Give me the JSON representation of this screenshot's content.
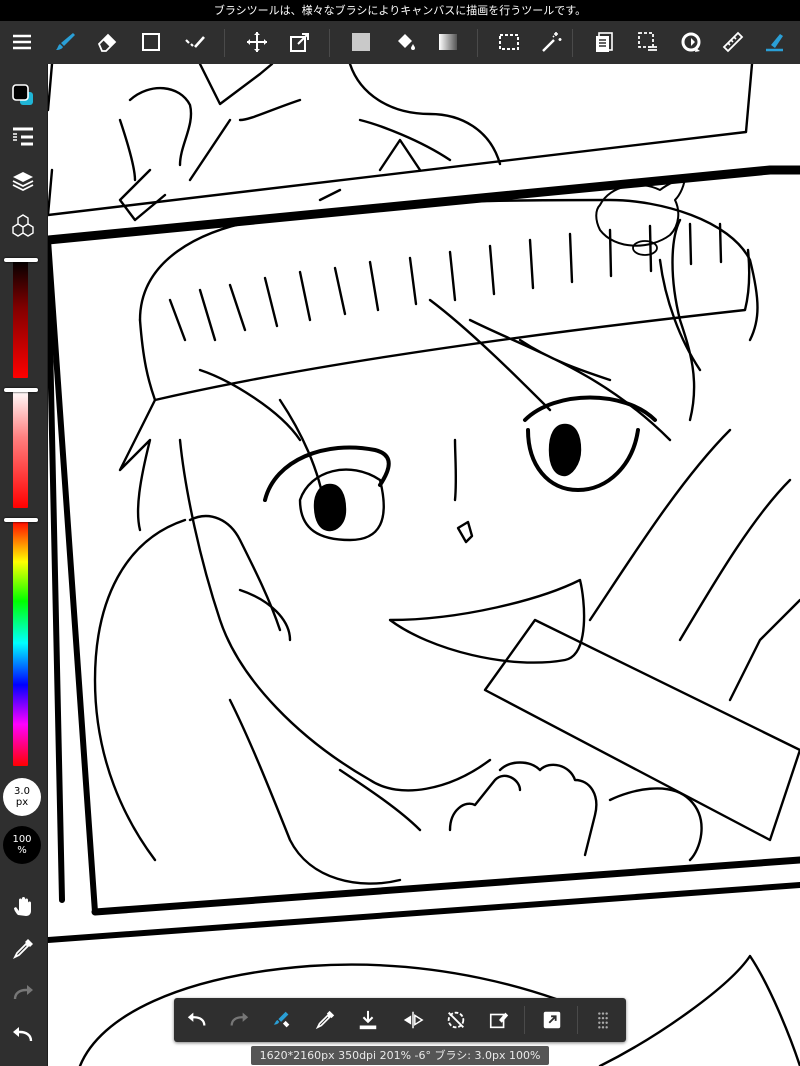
{
  "tooltip": "ブラシツールは、様々なブラシによりキャンバスに描画を行うツールです。",
  "top_toolbar": {
    "tools": [
      {
        "name": "menu-icon"
      },
      {
        "name": "brush-tool-icon",
        "active": true
      },
      {
        "name": "eraser-tool-icon"
      },
      {
        "name": "shape-tool-icon"
      },
      {
        "name": "select-pen-icon"
      },
      {
        "name": "move-tool-icon"
      },
      {
        "name": "transform-tool-icon"
      },
      {
        "name": "fill-color-icon"
      },
      {
        "name": "bucket-tool-icon"
      },
      {
        "name": "gradient-tool-icon"
      },
      {
        "name": "select-rect-icon"
      },
      {
        "name": "magic-wand-icon"
      },
      {
        "name": "pages-icon"
      },
      {
        "name": "select-area-icon"
      },
      {
        "name": "rotate-icon"
      },
      {
        "name": "ruler-icon"
      },
      {
        "name": "snap-pen-icon",
        "active": true
      }
    ]
  },
  "left_panel": {
    "brush_size": {
      "value": "3.0",
      "unit": "px"
    },
    "opacity": {
      "value": "100",
      "unit": "%"
    },
    "colors": {
      "foreground": "#000000",
      "background": "#1fb5d6",
      "accent": "#2a9fd6"
    }
  },
  "bottom_toolbar": {
    "buttons": [
      "undo",
      "redo",
      "brush-swap",
      "eyedropper",
      "save",
      "flip",
      "rotate-reset",
      "clear",
      "fullscreen",
      "more"
    ]
  },
  "status": "1620*2160px 350dpi 201% -6° ブラシ: 3.0px 100%"
}
